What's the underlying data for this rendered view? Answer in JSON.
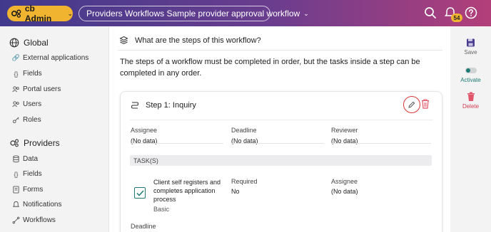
{
  "topbar": {
    "admin_label": "cb Admin",
    "workflow_title": "Providers Workflows Sample provider approval workflow",
    "notification_count": "54"
  },
  "sidebar": {
    "global_heading": "Global",
    "global_items": [
      {
        "label": "External applications",
        "icon": "link-icon"
      },
      {
        "label": "Fields",
        "icon": "braces-icon"
      },
      {
        "label": "Portal users",
        "icon": "users-icon"
      },
      {
        "label": "Users",
        "icon": "users-icon"
      },
      {
        "label": "Roles",
        "icon": "key-icon"
      }
    ],
    "providers_heading": "Providers",
    "provider_items": [
      {
        "label": "Data",
        "icon": "database-icon"
      },
      {
        "label": "Fields",
        "icon": "braces-icon"
      },
      {
        "label": "Forms",
        "icon": "form-icon"
      },
      {
        "label": "Notifications",
        "icon": "bell-icon"
      },
      {
        "label": "Workflows",
        "icon": "workflow-icon"
      }
    ]
  },
  "main": {
    "question": "What are the steps of this workflow?",
    "description": "The steps of a workflow must be completed in order, but the tasks inside a step can be completed in any order.",
    "step": {
      "title": "Step 1: Inquiry",
      "assignee_label": "Assignee",
      "assignee_value": "(No data)",
      "deadline_label": "Deadline",
      "deadline_value": "(No data)",
      "reviewer_label": "Reviewer",
      "reviewer_value": "(No data)",
      "tasks_header": "TASK(S)",
      "task": {
        "name": "Client self registers and completes application process",
        "type": "Basic",
        "required_label": "Required",
        "required_value": "No",
        "assignee_label": "Assignee",
        "assignee_value": "(No data)",
        "deadline_label": "Deadline"
      }
    }
  },
  "rail": {
    "save_label": "Save",
    "activate_label": "Activate",
    "delete_label": "Delete"
  },
  "colors": {
    "accent_yellow": "#f1b431",
    "teal": "#1f7a73",
    "delete_red": "#e0556a",
    "save_purple": "#4a3d8f"
  }
}
